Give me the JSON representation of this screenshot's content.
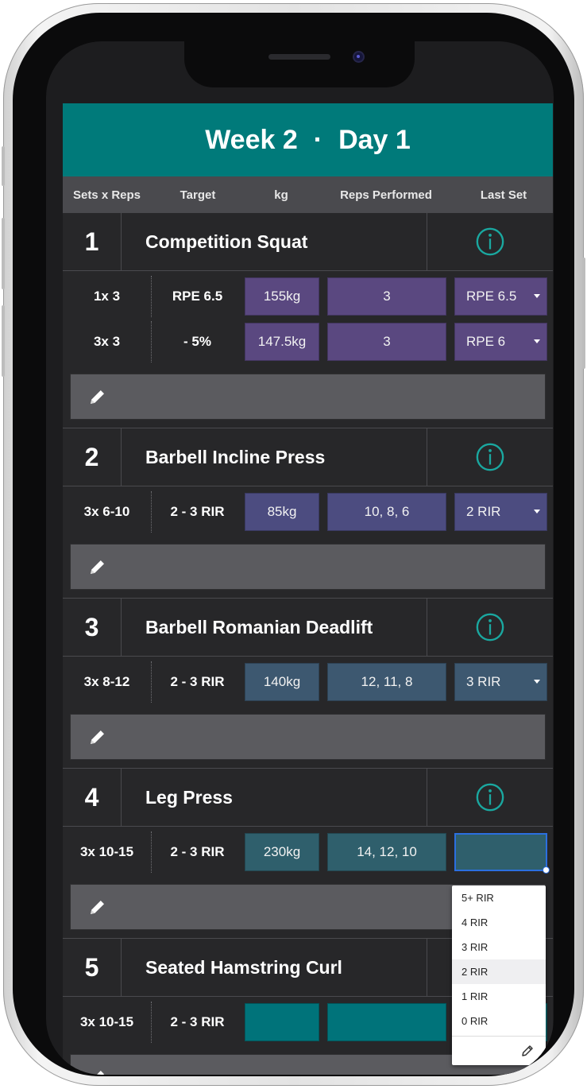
{
  "header": {
    "week": "Week 2",
    "separator": "·",
    "day": "Day 1",
    "color": "#007a7a"
  },
  "columns": [
    "Sets x Reps",
    "Target",
    "kg",
    "Reps Performed",
    "Last Set"
  ],
  "exercises": [
    {
      "num": "1",
      "name": "Competition Squat",
      "cell_color": "#5a4880",
      "icon": "info-circle-icon",
      "sets": [
        {
          "sets_reps": "1x 3",
          "target": "RPE 6.5",
          "kg": "155kg",
          "reps": "3",
          "last": "RPE 6.5"
        },
        {
          "sets_reps": "3x 3",
          "target": "- 5%",
          "kg": "147.5kg",
          "reps": "3",
          "last": "RPE 6"
        }
      ]
    },
    {
      "num": "2",
      "name": "Barbell Incline Press",
      "cell_color": "#4c4c80",
      "icon": "info-circle-icon",
      "sets": [
        {
          "sets_reps": "3x 6-10",
          "target": "2 - 3 RIR",
          "kg": "85kg",
          "reps": "10, 8, 6",
          "last": "2 RIR"
        }
      ]
    },
    {
      "num": "3",
      "name": "Barbell Romanian Deadlift",
      "cell_color": "#3d5870",
      "icon": "info-circle-icon",
      "sets": [
        {
          "sets_reps": "3x 8-12",
          "target": "2 - 3 RIR",
          "kg": "140kg",
          "reps": "12, 11, 8",
          "last": "3 RIR"
        }
      ]
    },
    {
      "num": "4",
      "name": "Leg Press",
      "cell_color": "#2f5f6c",
      "icon": "info-circle-icon",
      "sets": [
        {
          "sets_reps": "3x 10-15",
          "target": "2 - 3 RIR",
          "kg": "230kg",
          "reps": "14, 12, 10",
          "last": ""
        }
      ]
    },
    {
      "num": "5",
      "name": "Seated Hamstring Curl",
      "cell_color": "#00737a",
      "icon": "info-circle-icon",
      "sets": [
        {
          "sets_reps": "3x 10-15",
          "target": "2 - 3 RIR",
          "kg": "",
          "reps": "",
          "last": ""
        }
      ]
    }
  ],
  "dropdown": {
    "options": [
      "5+ RIR",
      "4 RIR",
      "3 RIR",
      "2 RIR",
      "1 RIR",
      "0 RIR"
    ],
    "highlighted": "2 RIR",
    "footer_icon": "pencil-icon"
  },
  "accent_info": "#1aa8a0"
}
